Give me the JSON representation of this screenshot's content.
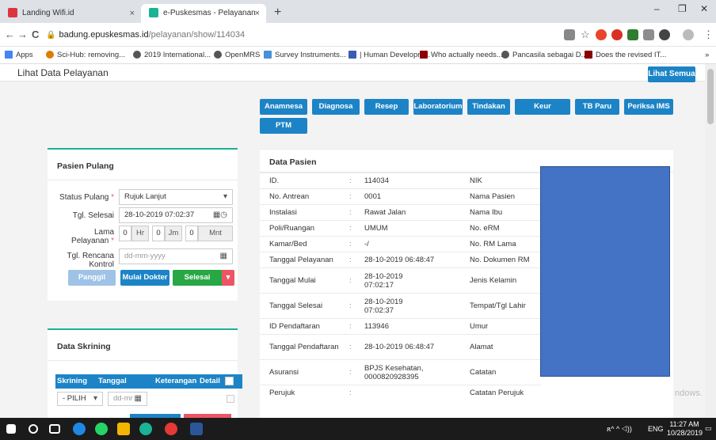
{
  "browser": {
    "tabs": [
      {
        "title": "Landing Wifi.id",
        "close": "×",
        "icon_color": "#d9363e"
      },
      {
        "title": "e-Puskesmas - Pelayanan Medis",
        "close": "×",
        "icon_color": "#1ab394"
      }
    ],
    "new_tab": "+",
    "window_controls": {
      "minimize": "–",
      "maximize": "❐",
      "close": "✕"
    },
    "nav": {
      "back": "←",
      "forward": "→",
      "reload": "C"
    },
    "url_host": "badung.epuskesmas.id",
    "url_path": "/pelayanan/show/114034",
    "star": "☆",
    "menu": "⋮",
    "bookmarks": [
      "Apps",
      "Sci-Hub: removing...",
      "2019 International...",
      "OpenMRS",
      "Survey Instruments...",
      "| Human Developm...",
      "Who actually needs...",
      "Pancasila sebagai D...",
      "Does the revised IT..."
    ],
    "bookmarks_more": "»"
  },
  "page": {
    "title": "Lihat Data Pelayanan",
    "lihat_semua": "Lihat Semua",
    "section_tabs": [
      "Anamnesa",
      "Diagnosa",
      "Resep",
      "Laboratorium",
      "Tindakan",
      "Keur",
      "TB Paru",
      "Periksa IMS",
      "PTM"
    ]
  },
  "pasien_pulang": {
    "title": "Pasien Pulang",
    "status_label": "Status Pulang",
    "status_value": "Rujuk Lanjut",
    "tgl_selesai_label": "Tgl. Selesai",
    "tgl_selesai_value": "28-10-2019 07:02:37",
    "lama_label_1": "Lama",
    "lama_label_2": "Pelayanan",
    "lama_hr": "0",
    "lama_hr_unit": "Hr",
    "lama_jm": "0",
    "lama_jm_unit": "Jm",
    "lama_mnt": "0",
    "lama_mnt_unit": "Mnt",
    "tgl_rencana_label_1": "Tgl. Rencana",
    "tgl_rencana_label_2": "Kontrol",
    "tgl_rencana_placeholder": "dd-mm-yyyy",
    "btn_panggil": "Panggil",
    "btn_mulai_dokter": "Mulai Dokter",
    "btn_selesai": "Selesai",
    "required_mark": "*"
  },
  "data_skrining": {
    "title": "Data Skrining",
    "headers": [
      "Skrining",
      "Tanggal",
      "Keterangan",
      "Detail"
    ],
    "select_value": "- PILIH",
    "date_placeholder": "dd-mr"
  },
  "data_pasien": {
    "title": "Data Pasien",
    "separator": ":",
    "rows": [
      {
        "k": "ID.",
        "v1": "114034",
        "v2": "",
        "k2": "NIK"
      },
      {
        "k": "No. Antrean",
        "v1": "0001",
        "v2": "",
        "k2": "Nama Pasien"
      },
      {
        "k": "Instalasi",
        "v1": "Rawat Jalan",
        "v2": "",
        "k2": "Nama Ibu"
      },
      {
        "k": "Poli/Ruangan",
        "v1": "UMUM",
        "v2": "",
        "k2": "No. eRM"
      },
      {
        "k": "Kamar/Bed",
        "v1": "-/",
        "v2": "",
        "k2": "No. RM Lama"
      },
      {
        "k": "Tanggal Pelayanan",
        "v1": "28-10-2019 06:48:47",
        "v2": "",
        "k2": "No. Dokumen RM"
      },
      {
        "k": "Tanggal Mulai",
        "v1": "28-10-2019",
        "v2": "07:02:17",
        "k2": "Jenis Kelamin"
      },
      {
        "k": "Tanggal Selesai",
        "v1": "28-10-2019",
        "v2": "07:02:37",
        "k2": "Tempat/Tgl Lahir"
      },
      {
        "k": "ID Pendaftaran",
        "v1": "113946",
        "v2": "",
        "k2": "Umur"
      },
      {
        "k": "Tanggal Pendaftaran",
        "v1": "28-10-2019 06:48:47",
        "v2": "",
        "k2": "Alamat"
      },
      {
        "k": "Asuransi",
        "v1": "BPJS Kesehatan,",
        "v2": "0000820928395",
        "k2": "Catatan"
      },
      {
        "k": "Perujuk",
        "v1": "",
        "v2": "",
        "k2": "Catatan Perujuk"
      }
    ]
  },
  "watermark": "ndows.",
  "taskbar": {
    "time": "11:27 AM",
    "date": "10/28/2019",
    "lang": "ENG",
    "tray": "ጸ^  ^  ◁)) "
  },
  "colors": {
    "primary": "#1c84c6",
    "success": "#1ab394",
    "green_btn": "#28a745",
    "danger": "#ed5565",
    "redaction": "#4472c4"
  }
}
